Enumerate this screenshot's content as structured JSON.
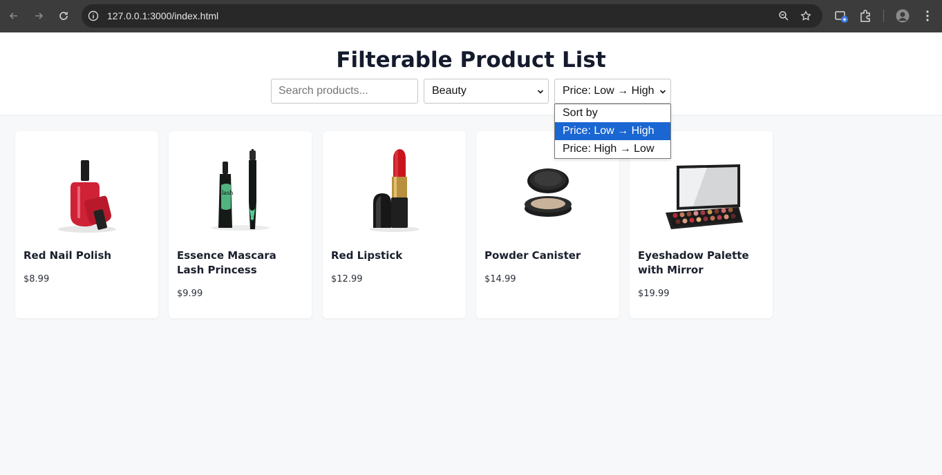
{
  "browser": {
    "url": "127.0.0.1:3000/index.html"
  },
  "page": {
    "title": "Filterable Product List",
    "search_placeholder": "Search products...",
    "category_selected": "Beauty",
    "sort_selected": "Price: Low → High",
    "sort_options": [
      "Sort by",
      "Price: Low → High",
      "Price: High → Low"
    ]
  },
  "products": [
    {
      "name": "Red Nail Polish",
      "price": "$8.99",
      "icon": "nail-polish-image"
    },
    {
      "name": "Essence Mascara Lash Princess",
      "price": "$9.99",
      "icon": "mascara-image"
    },
    {
      "name": "Red Lipstick",
      "price": "$12.99",
      "icon": "lipstick-image"
    },
    {
      "name": "Powder Canister",
      "price": "$14.99",
      "icon": "powder-canister-image"
    },
    {
      "name": "Eyeshadow Palette with Mirror",
      "price": "$19.99",
      "icon": "eyeshadow-palette-image"
    }
  ],
  "colors": {
    "selected_option": "#1a66d2",
    "title": "#141b2d",
    "page_bg": "#f7f8fa"
  }
}
